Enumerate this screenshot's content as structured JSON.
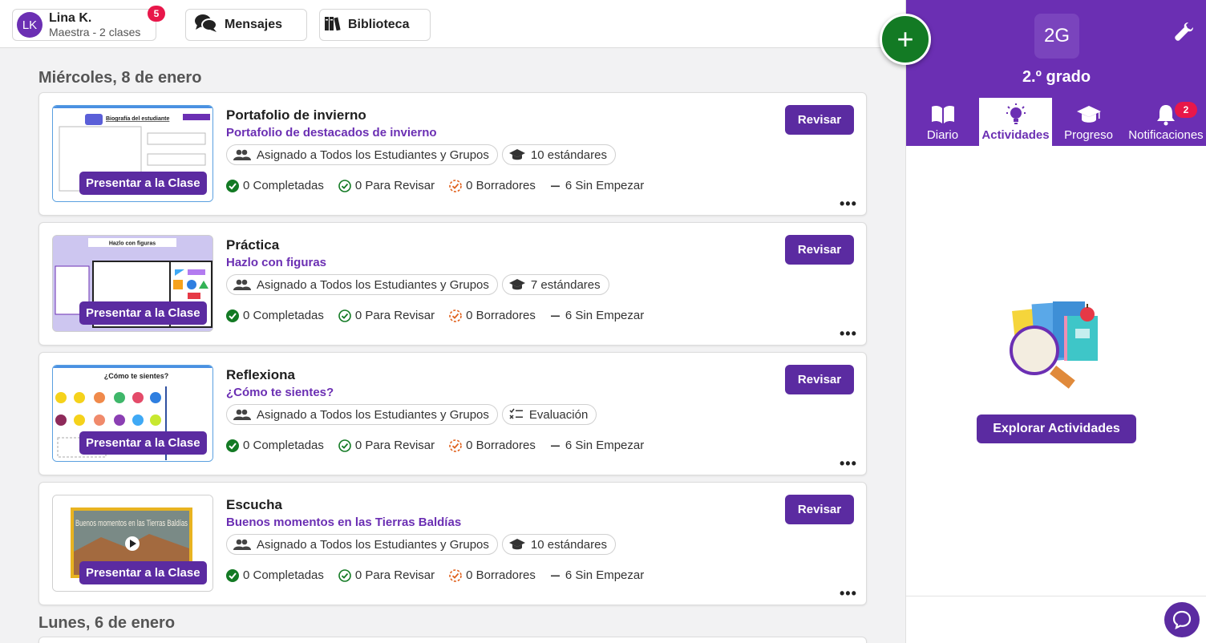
{
  "profile": {
    "initials": "LK",
    "name": "Lina K.",
    "subtitle": "Maestra - 2 clases",
    "badge": "5"
  },
  "nav": {
    "messages": "Mensajes",
    "library": "Biblioteca"
  },
  "fab": {
    "label": "+"
  },
  "feed": {
    "dates": [
      "Miércoles, 8 de enero",
      "Lunes, 6 de enero"
    ],
    "cards": [
      {
        "title": "Portafolio de invierno",
        "subtitle": "Portafolio de destacados de invierno",
        "assigned": "Asignado a Todos los Estudiantes y Grupos",
        "second_chip": "10 estándares",
        "second_chip_icon": "graduation-cap-icon",
        "present": "Presentar a la Clase",
        "review": "Revisar",
        "stats": {
          "completed": "0 Completadas",
          "to_review": "0 Para Revisar",
          "drafts": "0 Borradores",
          "not_started": "6 Sin Empezar"
        },
        "thumb_title": "Biografía del estudiante"
      },
      {
        "title": "Práctica",
        "subtitle": "Hazlo con figuras",
        "assigned": "Asignado a Todos los Estudiantes y Grupos",
        "second_chip": "7 estándares",
        "second_chip_icon": "graduation-cap-icon",
        "present": "Presentar a la Clase",
        "review": "Revisar",
        "stats": {
          "completed": "0 Completadas",
          "to_review": "0 Para Revisar",
          "drafts": "0 Borradores",
          "not_started": "6 Sin Empezar"
        },
        "thumb_title": "Hazlo con figuras"
      },
      {
        "title": "Reflexiona",
        "subtitle": "¿Cómo te sientes?",
        "assigned": "Asignado a Todos los Estudiantes y Grupos",
        "second_chip": "Evaluación",
        "second_chip_icon": "checklist-icon",
        "present": "Presentar a la Clase",
        "review": "Revisar",
        "stats": {
          "completed": "0 Completadas",
          "to_review": "0 Para Revisar",
          "drafts": "0 Borradores",
          "not_started": "6 Sin Empezar"
        },
        "thumb_title": "¿Cómo te sientes?"
      },
      {
        "title": "Escucha",
        "subtitle": "Buenos momentos en las Tierras Baldías",
        "assigned": "Asignado a Todos los Estudiantes y Grupos",
        "second_chip": "10 estándares",
        "second_chip_icon": "graduation-cap-icon",
        "present": "Presentar a la Clase",
        "review": "Revisar",
        "stats": {
          "completed": "0 Completadas",
          "to_review": "0 Para Revisar",
          "drafts": "0 Borradores",
          "not_started": "6 Sin Empezar"
        },
        "thumb_title": "Buenos momentos en las Tierras Baldías"
      }
    ]
  },
  "panel": {
    "class_code": "2G",
    "grade": "2.º grado",
    "tabs": [
      {
        "label": "Diario",
        "icon": "book-icon"
      },
      {
        "label": "Actividades",
        "icon": "lightbulb-icon",
        "active": true
      },
      {
        "label": "Progreso",
        "icon": "graduation-cap-icon"
      },
      {
        "label": "Notificaciones",
        "icon": "bell-icon",
        "badge": "2"
      }
    ],
    "explore": "Explorar Actividades"
  },
  "colors": {
    "purple": "#6b2fb3",
    "button_purple": "#5b2ba1",
    "green": "#137a24",
    "badge_red": "#e8174a"
  }
}
